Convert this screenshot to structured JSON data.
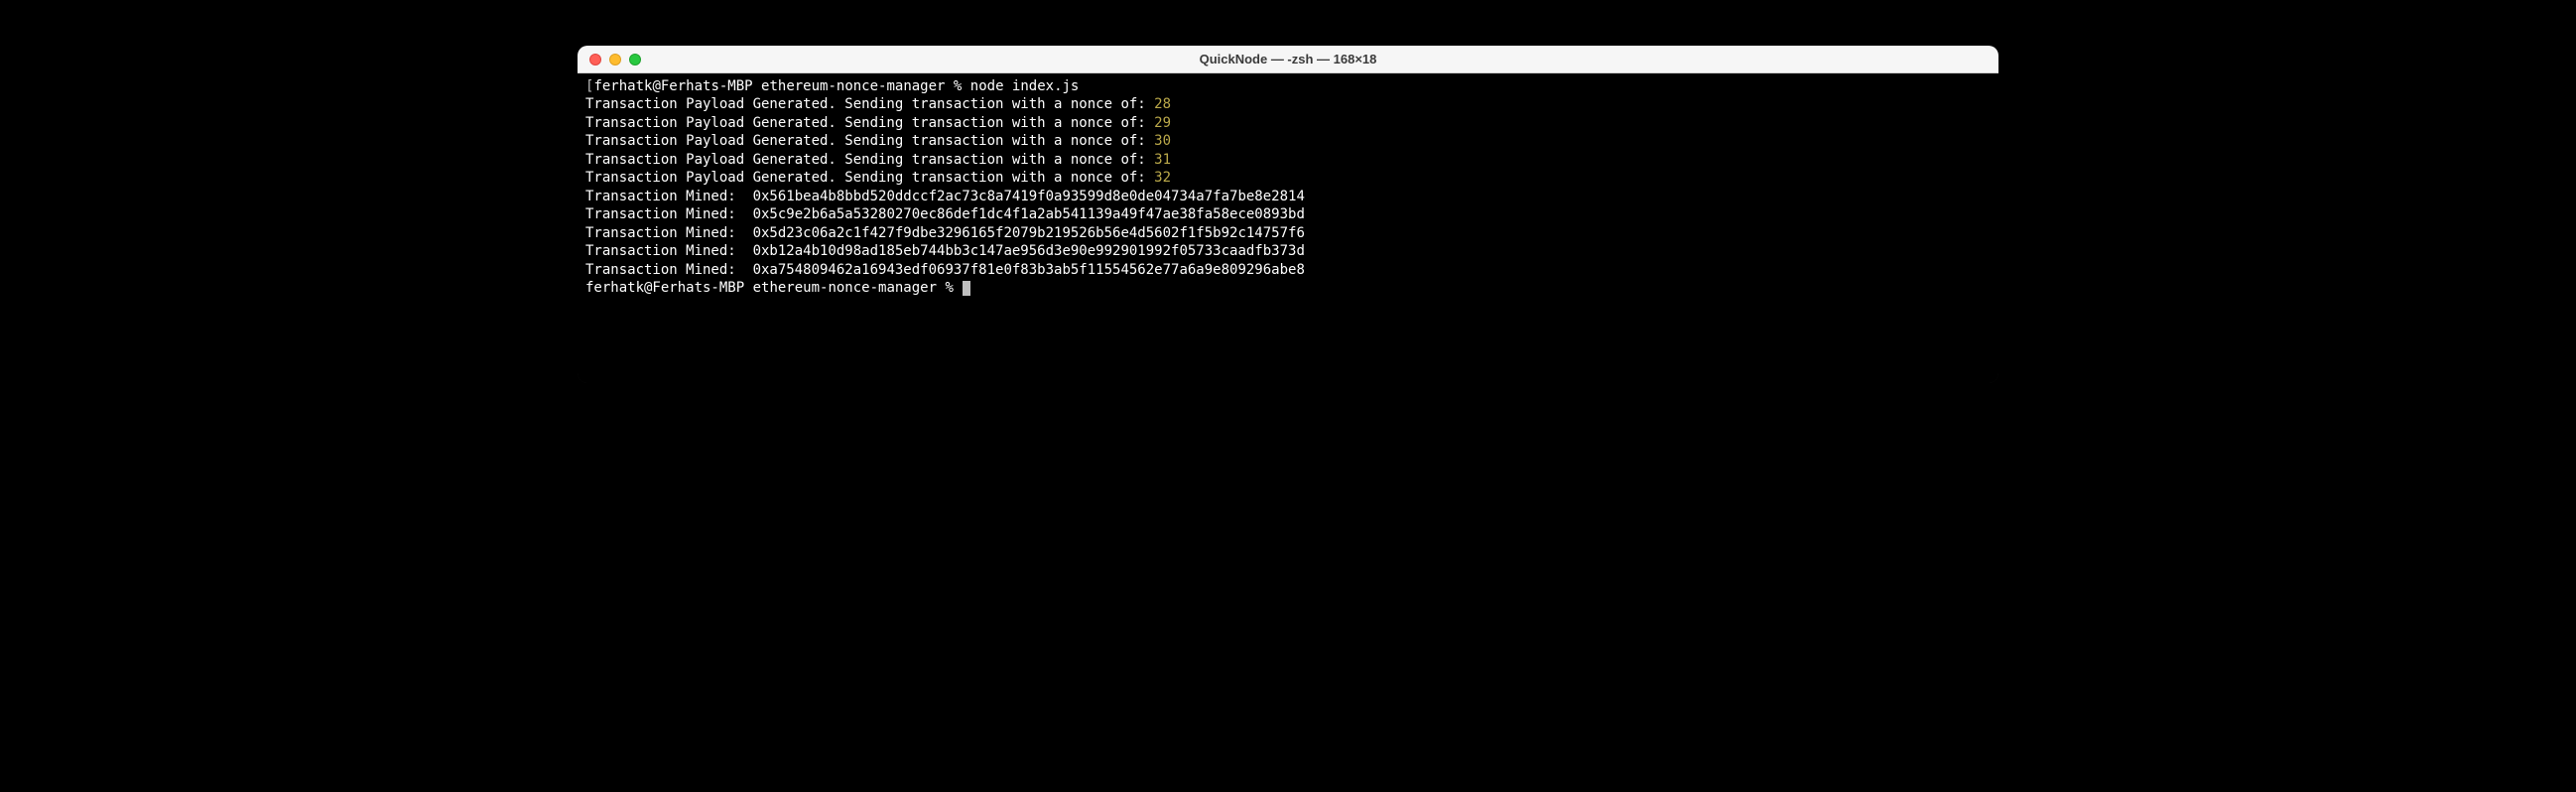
{
  "window": {
    "title": "QuickNode — -zsh — 168×18"
  },
  "prompt": {
    "open_bracket": "[",
    "close_bracket": "]",
    "user_host": "ferhatk@Ferhats-MBP",
    "directory": "ethereum-nonce-manager",
    "symbol": "%",
    "command": "node index.js"
  },
  "payload_prefix": "Transaction Payload Generated. Sending transaction with a nonce of:",
  "payloads": [
    {
      "nonce": "28"
    },
    {
      "nonce": "29"
    },
    {
      "nonce": "30"
    },
    {
      "nonce": "31"
    },
    {
      "nonce": "32"
    }
  ],
  "mined_prefix": "Transaction Mined:",
  "mined": [
    {
      "hash": "0x561bea4b8bbd520ddccf2ac73c8a7419f0a93599d8e0de04734a7fa7be8e2814"
    },
    {
      "hash": "0x5c9e2b6a5a53280270ec86def1dc4f1a2ab541139a49f47ae38fa58ece0893bd"
    },
    {
      "hash": "0x5d23c06a2c1f427f9dbe3296165f2079b219526b56e4d5602f1f5b92c14757f6"
    },
    {
      "hash": "0xb12a4b10d98ad185eb744bb3c147ae956d3e90e992901992f05733caadfb373d"
    },
    {
      "hash": "0xa754809462a16943edf06937f81e0f83b3ab5f11554562e77a6a9e809296abe8"
    }
  ]
}
